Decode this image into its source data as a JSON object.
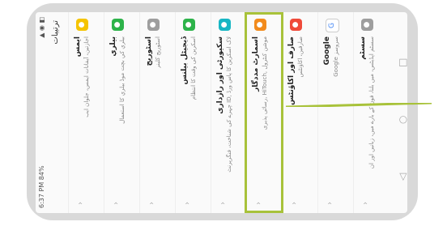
{
  "status": {
    "time": "6:37 PM",
    "battery": "84%",
    "icons": "signal-wifi-icons"
  },
  "app_title": "ترتيبات",
  "items": [
    {
      "name": "ايمس",
      "desc": "اجازتين، آيفانات ايمس، جلوان ايب",
      "color": "#f5c400",
      "icon": "grid-icon"
    },
    {
      "name": "بیلري",
      "desc": "بيلري كي بچت موڈ بيلري كا استعمال",
      "color": "#2db34a",
      "icon": "battery-icon"
    },
    {
      "name": "اسٹوریج",
      "desc": "اسٹوریج کلینر",
      "color": "#9e9e9e",
      "icon": "storage-icon"
    },
    {
      "name": "ڈیجیٹل بیلنس",
      "desc": "اسکرین کی وقت کا انتظام",
      "color": "#2db34a",
      "icon": "balance-icon"
    },
    {
      "name": "سکیورٹی اور رازداری",
      "desc": "چہرے کی شناخت، فنگرپرنٹ ID, لاک اسکرین کا پاس ورڈ",
      "color": "#17b6c4",
      "icon": "shield-icon"
    },
    {
      "name": "اسمارٹ مددگار",
      "desc": "رسائی پذیری, HiTouch, موشن کنٹرول",
      "color": "#f28b1c",
      "icon": "assistant-icon"
    },
    {
      "name": "صارف اور اکاؤنٹس",
      "desc": "صارفین، اکاؤنٹس",
      "color": "#ef4a3a",
      "icon": "user-icon"
    },
    {
      "name": "Google",
      "desc": "Google سروسز",
      "color": "#ffffff",
      "icon": "google-icon"
    },
    {
      "name": "سسٹم",
      "desc": "سسٹم اپڈیٹس، میں بلنا، فون کے بارے میں، زبانیں اور ان",
      "color": "#9e9e9e",
      "icon": "system-icon"
    }
  ]
}
